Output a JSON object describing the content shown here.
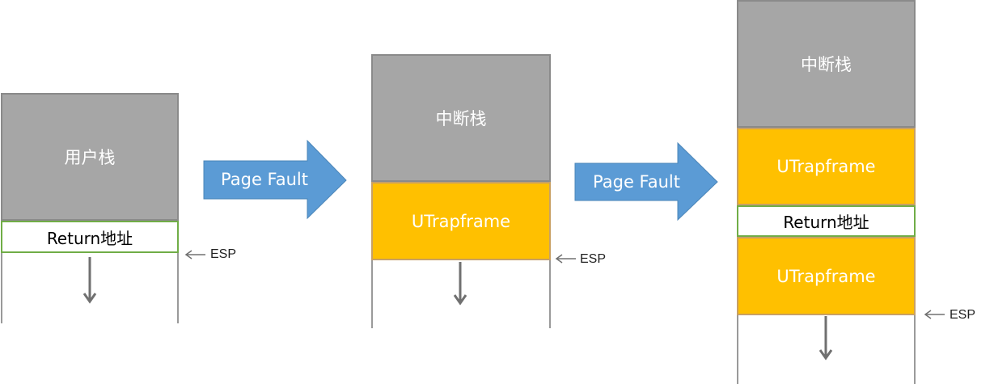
{
  "stage1": {
    "user_stack": "用户栈",
    "return_addr": "Return地址",
    "esp": "ESP"
  },
  "arrow1": {
    "label": "Page Fault"
  },
  "stage2": {
    "interrupt_stack": "中断栈",
    "utrapframe": "UTrapframe",
    "esp": "ESP"
  },
  "arrow2": {
    "label": "Page Fault"
  },
  "stage3": {
    "interrupt_stack": "中断栈",
    "utrapframe_top": "UTrapframe",
    "return_addr": "Return地址",
    "utrapframe_bottom": "UTrapframe",
    "esp": "ESP"
  },
  "colors": {
    "stack_gray": "#a6a6a6",
    "frame_yellow": "#ffc000",
    "return_border_green": "#70ad47",
    "arrow_blue": "#5b9bd5"
  }
}
